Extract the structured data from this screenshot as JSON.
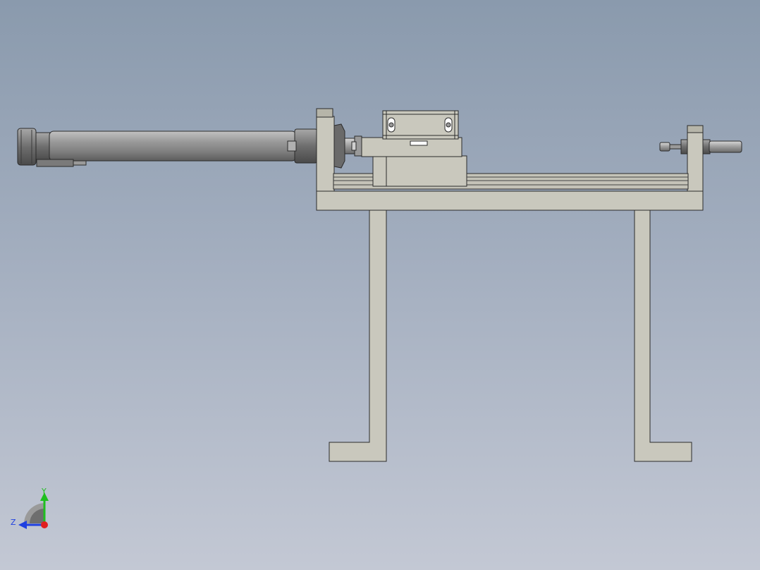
{
  "colors": {
    "background_top": "#8a9aad",
    "background_bottom": "#c3c8d4",
    "part_fill": "#c9c8bd",
    "part_fill_dark": "#a9a89c",
    "edge": "#2b2b2b",
    "cylinder_body": "#8f8f8f",
    "axis_y": "#1fbf1f",
    "axis_z": "#1e3fe0",
    "axis_x_origin": "#e01f1f"
  },
  "triad": {
    "y_label": "Y",
    "z_label": "Z"
  }
}
